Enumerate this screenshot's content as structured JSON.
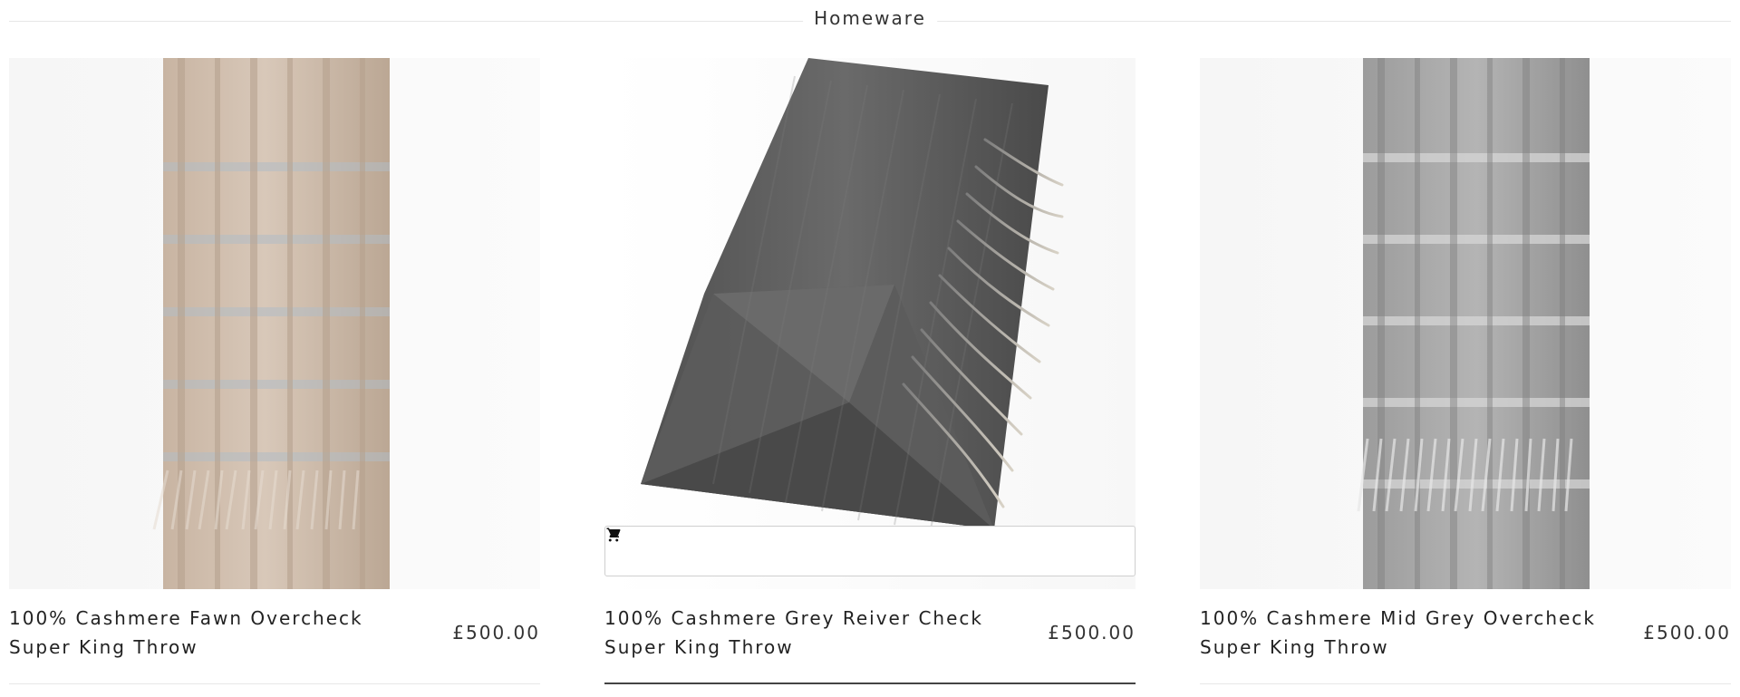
{
  "section": {
    "title": "Homeware"
  },
  "products": [
    {
      "name": "100% Cashmere Fawn Overcheck Super King Throw",
      "price": "£500.00",
      "image_icon": "fawn-throw-image"
    },
    {
      "name": "100% Cashmere Grey Reiver Check Super King Throw",
      "price": "£500.00",
      "image_icon": "grey-throw-image",
      "add_to_cart_icon": "cart-icon"
    },
    {
      "name": "100% Cashmere Mid Grey Overcheck Super King Throw",
      "price": "£500.00",
      "image_icon": "mid-grey-throw-image"
    }
  ],
  "colors": {
    "fawn": "#c9b6a4",
    "grey": "#5b5b5b",
    "mid_grey": "#9a9a9a",
    "underline": "#e7e7e7",
    "active_underline": "#444444"
  }
}
